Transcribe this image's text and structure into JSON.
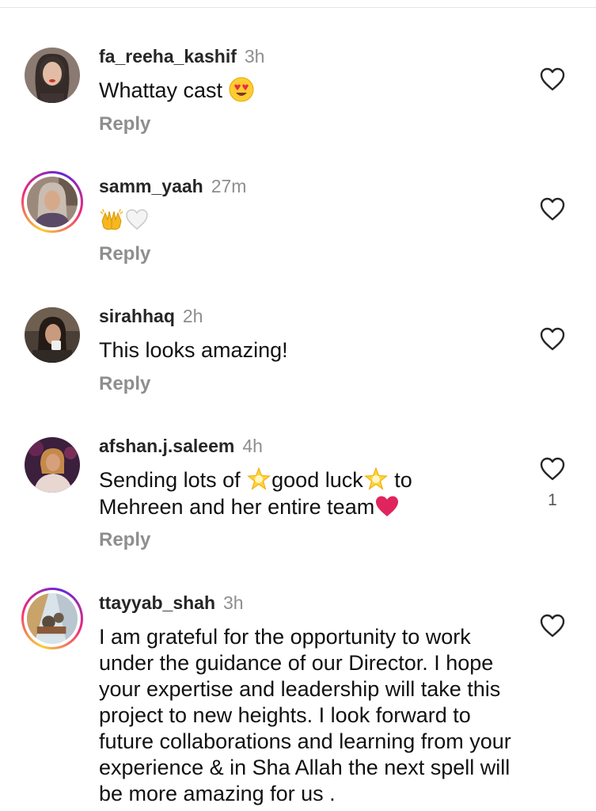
{
  "comments": [
    {
      "username": "fa_reeha_kashif",
      "time": "3h",
      "text_before": "Whattay cast ",
      "emoji_after": "heart-eyes-emoji",
      "reply_label": "Reply"
    },
    {
      "username": "samm_yaah",
      "time": "27m",
      "emojis": [
        "raising-hands-emoji",
        "white-heart-emoji"
      ],
      "reply_label": "Reply"
    },
    {
      "username": "sirahhaq",
      "time": "2h",
      "text": "This looks amazing!",
      "reply_label": "Reply"
    },
    {
      "username": "afshan.j.saleem",
      "time": "4h",
      "text_part1": "Sending lots of ",
      "text_part2": "good luck",
      "text_part3": " to",
      "text_line2": "Mehreen and her entire team",
      "like_count": "1",
      "reply_label": "Reply"
    },
    {
      "username": "ttayyab_shah",
      "time": "3h",
      "text": "I am grateful for the opportunity to work under the guidance of our Director. I hope your expertise and leadership will take this project to new heights. I look forward to future collaborations and learning from your experience & in Sha Allah the next spell will be more amazing for us ."
    }
  ],
  "colors": {
    "username": "#262626",
    "meta_gray": "#8e8e8e",
    "text": "#111111",
    "heart_red": "#e0245e"
  }
}
